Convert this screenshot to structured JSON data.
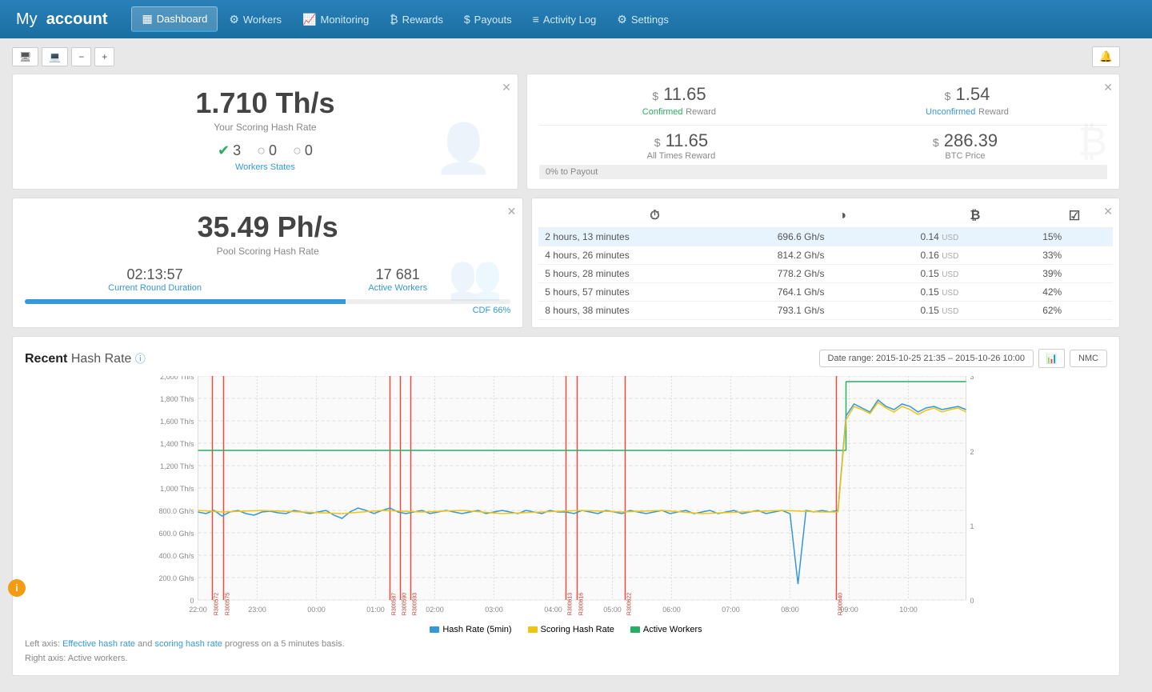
{
  "header": {
    "title": "My account",
    "title_my": "My",
    "title_account": "account"
  },
  "nav": {
    "items": [
      {
        "id": "dashboard",
        "label": "Dashboard",
        "icon": "▦",
        "active": true
      },
      {
        "id": "workers",
        "label": "Workers",
        "icon": "⚙",
        "active": false
      },
      {
        "id": "monitoring",
        "label": "Monitoring",
        "icon": "📈",
        "active": false
      },
      {
        "id": "rewards",
        "label": "Rewards",
        "icon": "₿",
        "active": false
      },
      {
        "id": "payouts",
        "label": "Payouts",
        "icon": "$",
        "active": false
      },
      {
        "id": "activity-log",
        "label": "Activity Log",
        "icon": "≡",
        "active": false
      },
      {
        "id": "settings",
        "label": "Settings",
        "icon": "⚙",
        "active": false
      }
    ]
  },
  "toolbar": {
    "monitor_icon": "🖥",
    "desktop_icon": "💻",
    "minus_label": "−",
    "plus_label": "+"
  },
  "hashrate_widget": {
    "value": "1.710 Th/s",
    "label": "Your Scoring Hash Rate",
    "workers": {
      "active": "3",
      "inactive1": "0",
      "inactive2": "0",
      "states_label": "Workers States"
    }
  },
  "reward_widget": {
    "confirmed_amount": "11.65",
    "confirmed_label": "Confirmed",
    "confirmed_reward": "Reward",
    "unconfirmed_amount": "1.54",
    "unconfirmed_label": "Unconfirmed",
    "unconfirmed_reward": "Reward",
    "alltimes_amount": "11.65",
    "alltimes_label": "All Times Reward",
    "btc_price": "286.39",
    "btc_label": "BTC Price",
    "payout_progress": "0% to Payout",
    "dollar_sign": "$"
  },
  "pool_widget": {
    "value": "35.49 Ph/s",
    "label": "Pool Scoring Hash Rate",
    "round_duration": "02:13:57",
    "round_label": "Current Round Duration",
    "active_workers": "17 681",
    "workers_label": "Active Workers",
    "cdf_percent": 66,
    "cdf_label": "CDF 66%"
  },
  "table_widget": {
    "headers": [
      "⏱",
      "◑",
      "₿",
      "☑"
    ],
    "rows": [
      {
        "time": "2 hours, 13 minutes",
        "hashrate": "696.6 Gh/s",
        "value": "0.14",
        "currency": "USD",
        "pct": "15%",
        "highlight": true
      },
      {
        "time": "4 hours, 26 minutes",
        "hashrate": "814.2 Gh/s",
        "value": "0.16",
        "currency": "USD",
        "pct": "33%",
        "highlight": false
      },
      {
        "time": "5 hours, 28 minutes",
        "hashrate": "778.2 Gh/s",
        "value": "0.15",
        "currency": "USD",
        "pct": "39%",
        "highlight": false
      },
      {
        "time": "5 hours, 57 minutes",
        "hashrate": "764.1 Gh/s",
        "value": "0.15",
        "currency": "USD",
        "pct": "42%",
        "highlight": false
      },
      {
        "time": "8 hours, 38 minutes",
        "hashrate": "793.1 Gh/s",
        "value": "0.15",
        "currency": "USD",
        "pct": "62%",
        "highlight": false
      }
    ]
  },
  "chart": {
    "title_recent": "Recent",
    "title_hashrate": "Hash Rate",
    "date_range": "Date range: 2015-10-25 21:35 – 2015-10-26 10:00",
    "nmc_button": "NMC",
    "y_labels_left": [
      "2,000 Th/s",
      "1,800 Th/s",
      "1,600 Th/s",
      "1,400 Th/s",
      "1,200 Th/s",
      "1,000 Th/s",
      "800.0 Gh/s",
      "600.0 Gh/s",
      "400.0 Gh/s",
      "200.0 Gh/s",
      "0"
    ],
    "y_labels_right": [
      "3",
      "2",
      "1",
      "0"
    ],
    "x_labels": [
      "22:00",
      "23:00",
      "00:00",
      "01:00",
      "02:00",
      "03:00",
      "04:00",
      "05:00",
      "06:00",
      "07:00",
      "08:00",
      "09:00",
      "10:00"
    ],
    "legend": {
      "hashrate_label": "Hash Rate (5min)",
      "scoring_label": "Scoring Hash Rate",
      "workers_label": "Active Workers"
    },
    "note_left": "Left axis:",
    "note_left_text1": "Effective hash rate",
    "note_left_and": "and",
    "note_left_text2": "scoring hash rate",
    "note_left_suffix": "progress on a 5 minutes basis.",
    "note_right": "Right axis: Active workers."
  },
  "info_badge": {
    "label": "i"
  }
}
